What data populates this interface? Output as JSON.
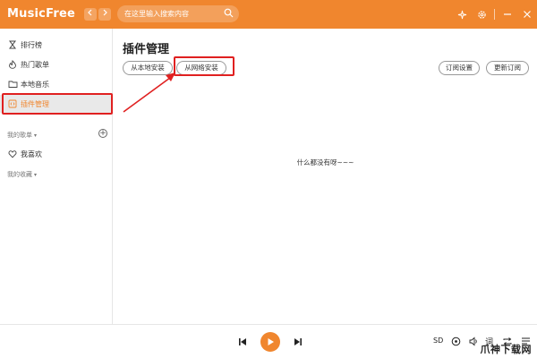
{
  "app": {
    "title": "MusicFree"
  },
  "titlebar": {
    "back_icon": "chevron-left-icon",
    "forward_icon": "chevron-right-icon",
    "search_placeholder": "在这里输入搜索内容",
    "icons": [
      "theme-icon",
      "settings-icon",
      "minimize-icon",
      "close-icon"
    ],
    "accent": "#f0862e"
  },
  "sidebar": {
    "items": [
      {
        "label": "排行榜",
        "icon": "hourglass-icon"
      },
      {
        "label": "热门歌单",
        "icon": "fire-icon"
      },
      {
        "label": "本地音乐",
        "icon": "folder-icon"
      },
      {
        "label": "插件管理",
        "icon": "plugin-icon",
        "active": true
      }
    ],
    "my_playlists": "我的歌单",
    "favorites": "我喜欢",
    "my_collections": "我的收藏"
  },
  "main": {
    "title": "插件管理",
    "buttons": {
      "install_local": "从本地安装",
      "install_network": "从网络安装",
      "subscription_settings": "订阅设置",
      "update_subscription": "更新订阅"
    },
    "empty_text": "什么都没有呀~~~"
  },
  "player": {
    "quality": "SD",
    "lyrics": "词",
    "icons": [
      "prev-icon",
      "play-icon",
      "next-icon",
      "sound-icon",
      "repeat-icon",
      "playlist-icon"
    ]
  },
  "watermark": "爪神下载网",
  "annotation_color": "#e02020"
}
